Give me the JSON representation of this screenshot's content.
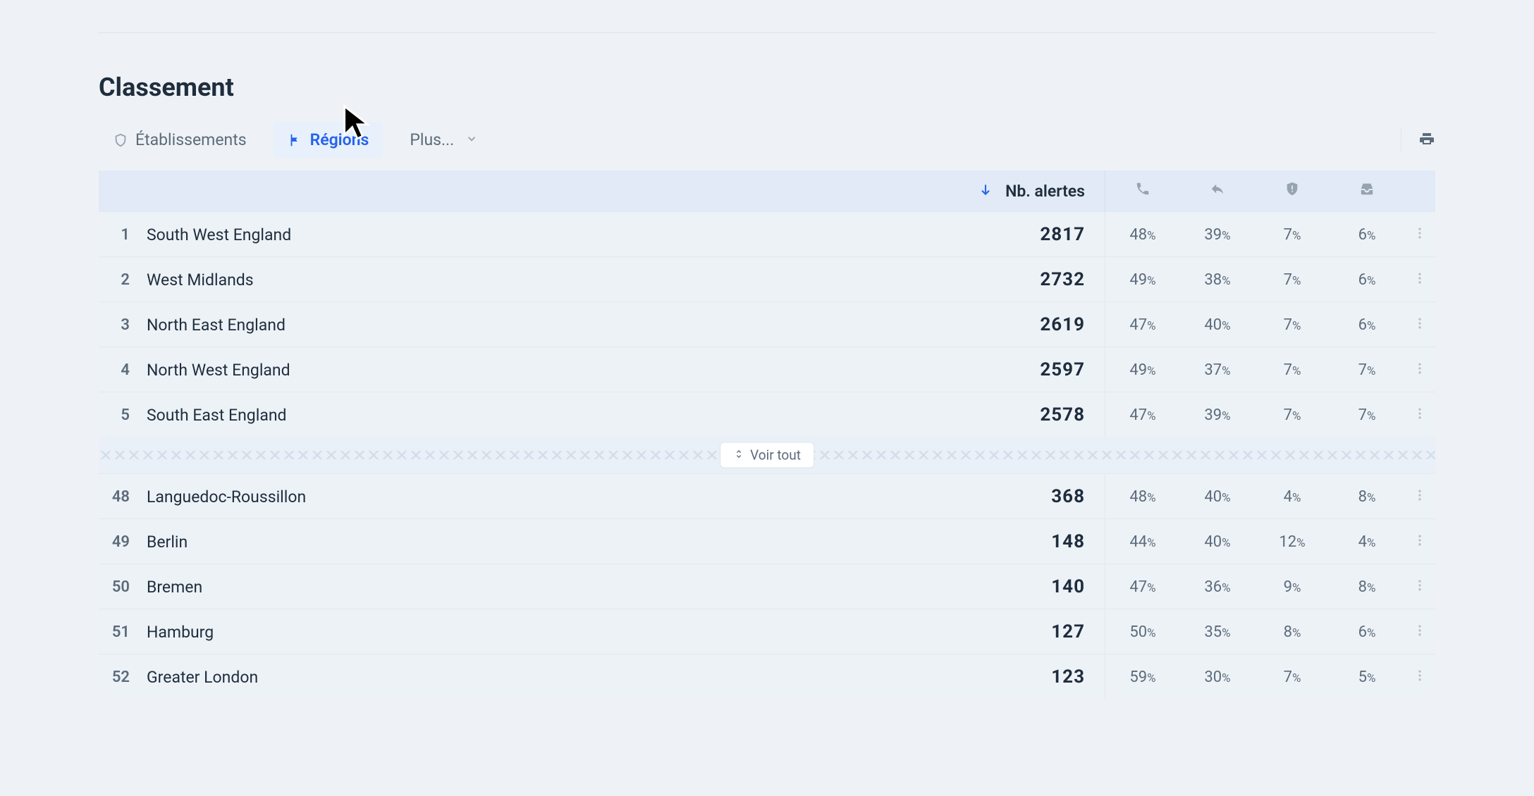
{
  "title": "Classement",
  "tabs": {
    "establishments": "Établissements",
    "regions": "Régions",
    "more": "Plus..."
  },
  "columns": {
    "alerts": "Nb. alertes"
  },
  "expand_label": "Voir tout",
  "top_rows": [
    {
      "rank": "1",
      "name": "South West England",
      "value": "2817",
      "p1": "48",
      "p2": "39",
      "p3": "7",
      "p4": "6"
    },
    {
      "rank": "2",
      "name": "West Midlands",
      "value": "2732",
      "p1": "49",
      "p2": "38",
      "p3": "7",
      "p4": "6"
    },
    {
      "rank": "3",
      "name": "North East England",
      "value": "2619",
      "p1": "47",
      "p2": "40",
      "p3": "7",
      "p4": "6"
    },
    {
      "rank": "4",
      "name": "North West England",
      "value": "2597",
      "p1": "49",
      "p2": "37",
      "p3": "7",
      "p4": "7"
    },
    {
      "rank": "5",
      "name": "South East England",
      "value": "2578",
      "p1": "47",
      "p2": "39",
      "p3": "7",
      "p4": "7"
    }
  ],
  "bottom_rows": [
    {
      "rank": "48",
      "name": "Languedoc-Roussillon",
      "value": "368",
      "p1": "48",
      "p2": "40",
      "p3": "4",
      "p4": "8"
    },
    {
      "rank": "49",
      "name": "Berlin",
      "value": "148",
      "p1": "44",
      "p2": "40",
      "p3": "12",
      "p4": "4"
    },
    {
      "rank": "50",
      "name": "Bremen",
      "value": "140",
      "p1": "47",
      "p2": "36",
      "p3": "9",
      "p4": "8"
    },
    {
      "rank": "51",
      "name": "Hamburg",
      "value": "127",
      "p1": "50",
      "p2": "35",
      "p3": "8",
      "p4": "6"
    },
    {
      "rank": "52",
      "name": "Greater London",
      "value": "123",
      "p1": "59",
      "p2": "30",
      "p3": "7",
      "p4": "5"
    }
  ]
}
